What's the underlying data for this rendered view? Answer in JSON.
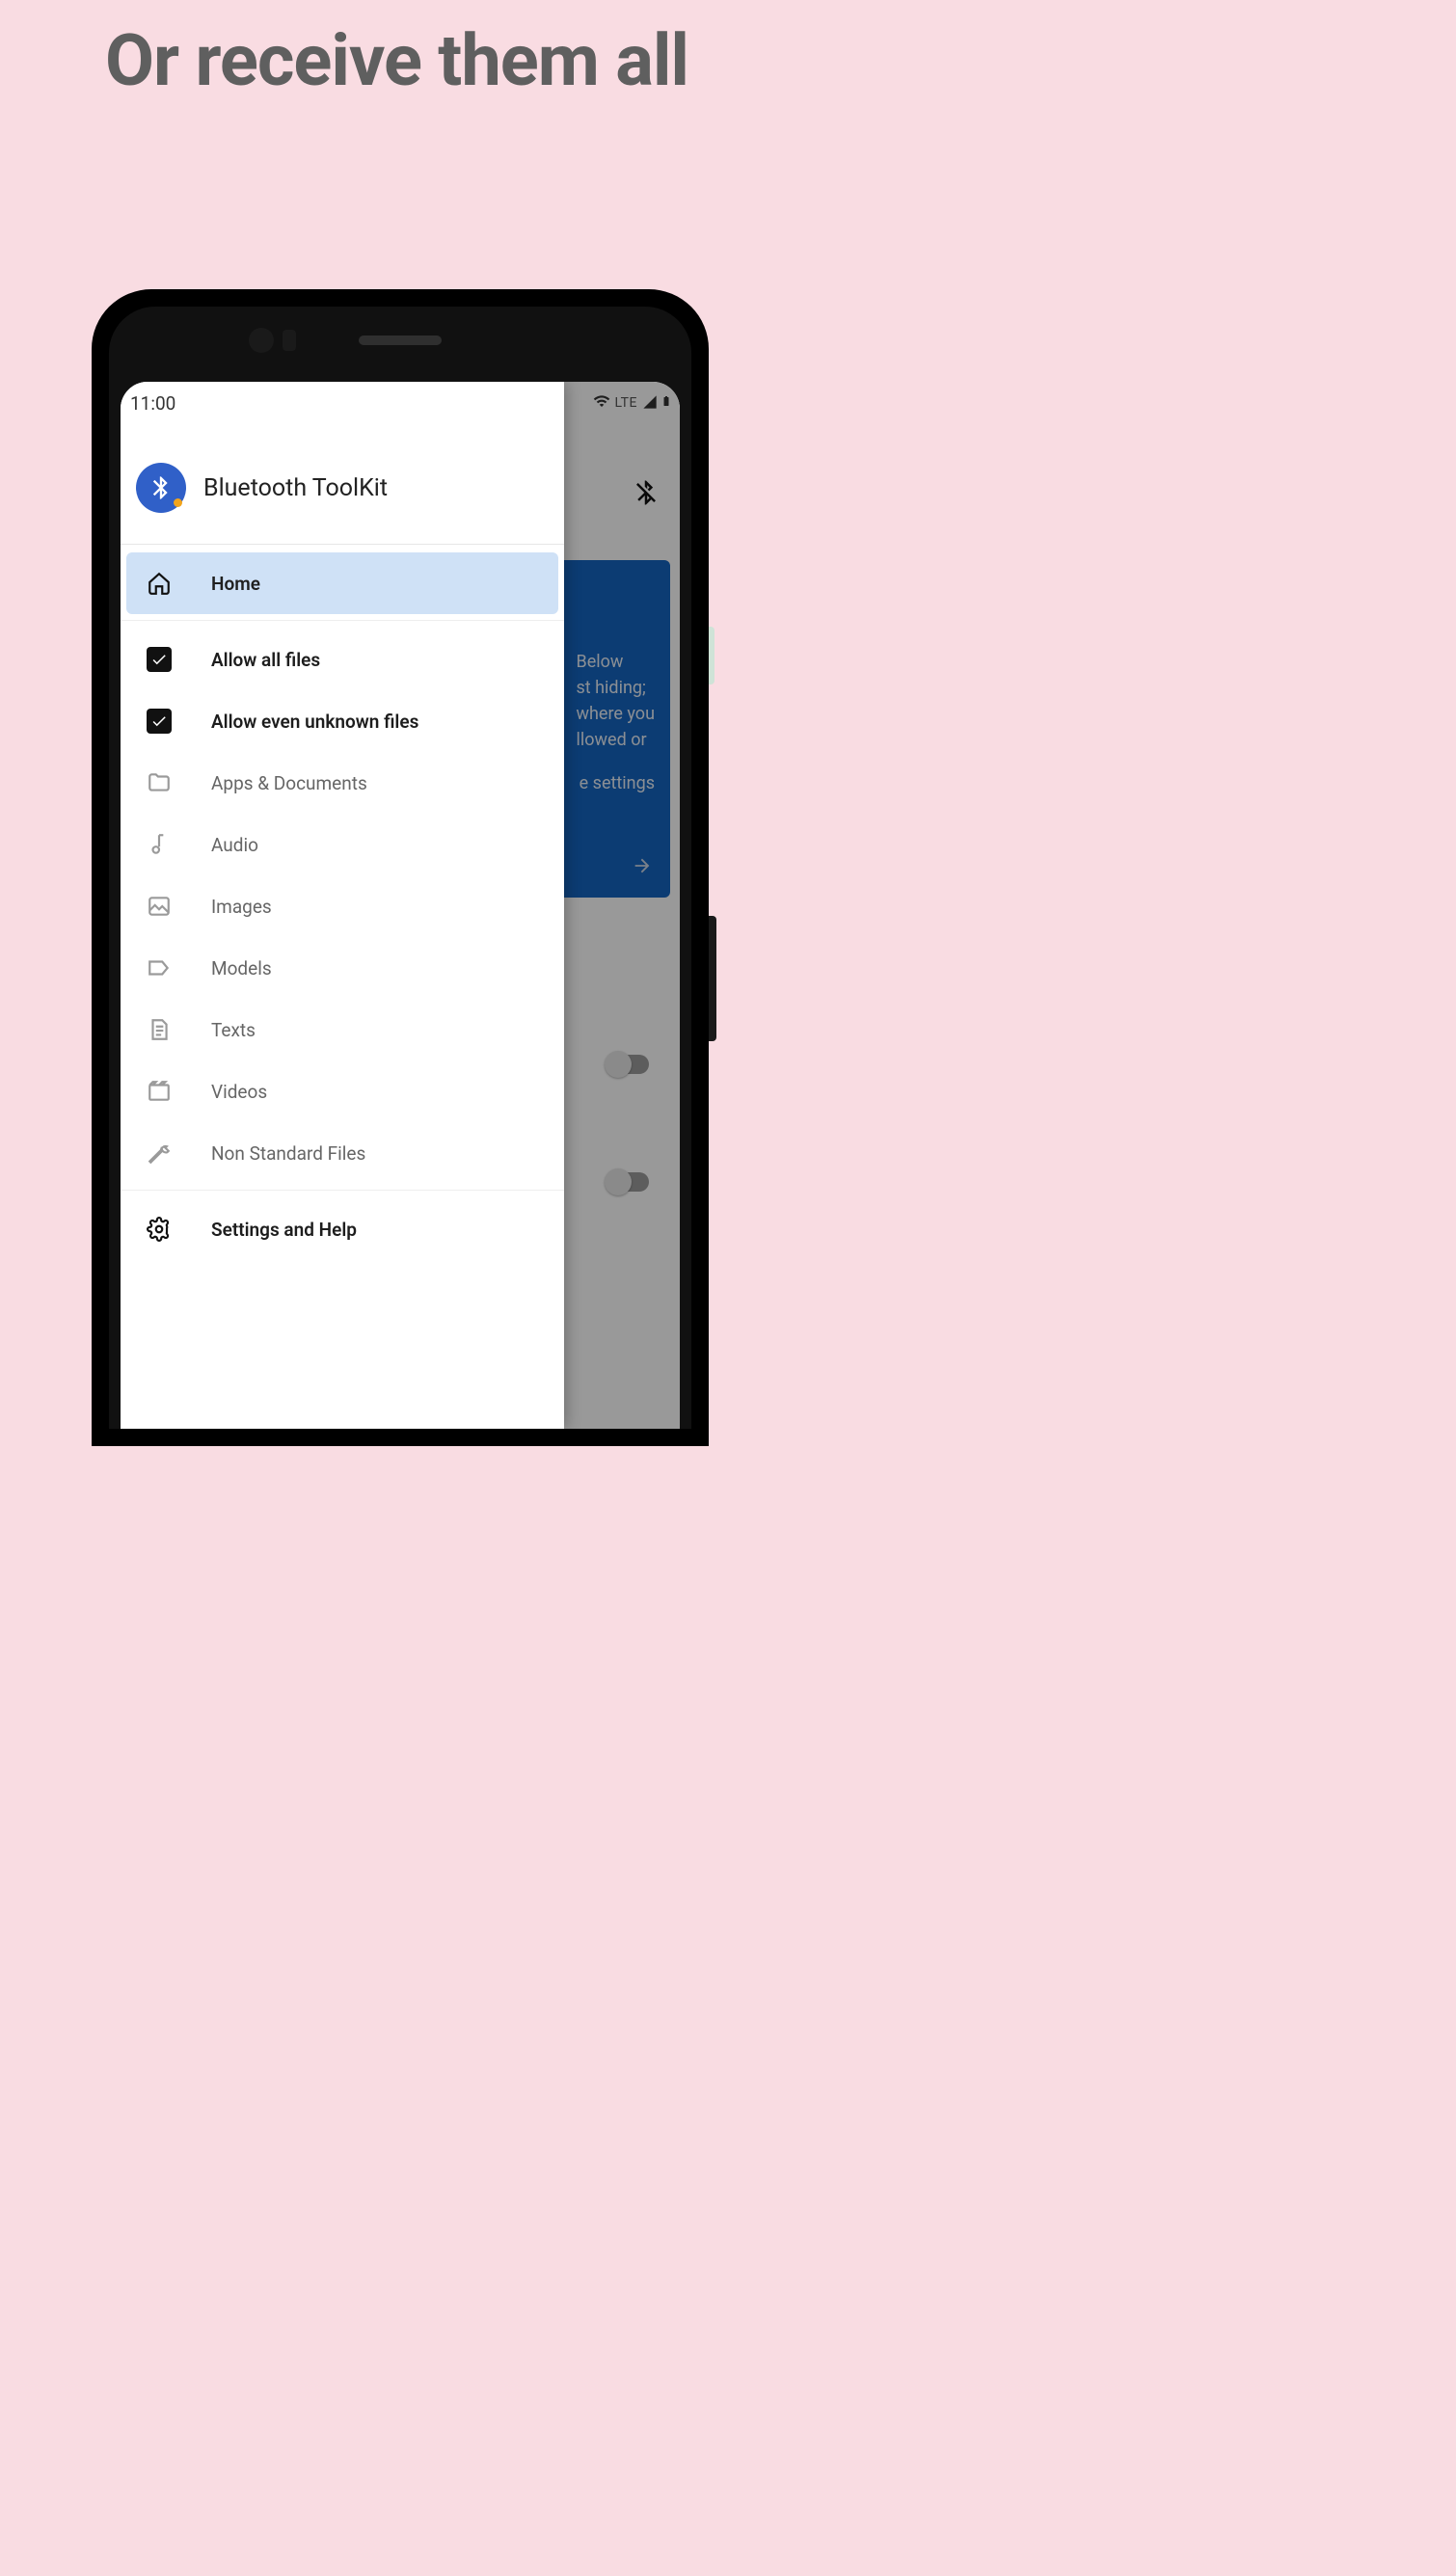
{
  "headline": "Or receive them all",
  "status": {
    "time": "11:00",
    "network": "LTE"
  },
  "app_title": "Bluetooth ToolKit",
  "nav": {
    "home": "Home",
    "allow_all": "Allow all files",
    "allow_unknown": "Allow even unknown files",
    "apps_docs": "Apps & Documents",
    "audio": "Audio",
    "images": "Images",
    "models": "Models",
    "texts": "Texts",
    "videos": "Videos",
    "non_standard": "Non Standard Files",
    "settings_help": "Settings and Help"
  },
  "behind": {
    "line1": "Below",
    "line2": "st hiding;",
    "line3": "where you",
    "line4": "llowed or",
    "line5": "e settings"
  }
}
